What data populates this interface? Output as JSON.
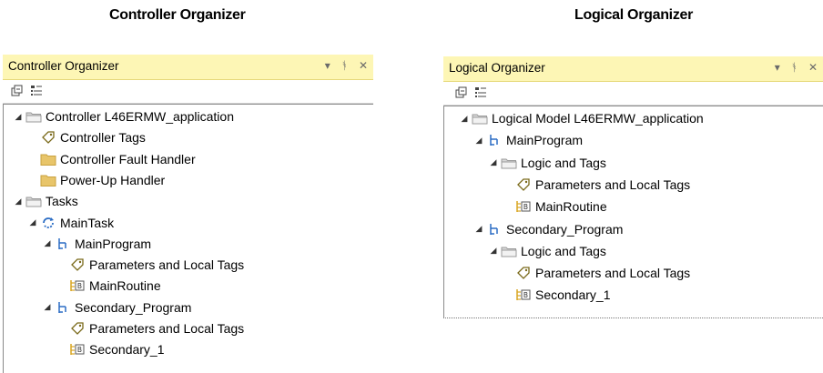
{
  "captions": {
    "left": "Controller Organizer",
    "right": "Logical Organizer"
  },
  "controller_organizer": {
    "title": "Controller Organizer",
    "title_icons": [
      "dropdown-icon",
      "pin-icon",
      "close-icon"
    ],
    "toolbar_icons": [
      "collapse-all-icon",
      "expand-all-icon"
    ],
    "items": [
      {
        "label": "Controller L46ERMW_application",
        "icon": "folder-open-icon",
        "expanded": true
      },
      {
        "label": "Controller Tags",
        "icon": "tag-icon"
      },
      {
        "label": "Controller Fault Handler",
        "icon": "folder-icon"
      },
      {
        "label": "Power-Up Handler",
        "icon": "folder-icon"
      },
      {
        "label": "Tasks",
        "icon": "folder-open-icon",
        "expanded": true
      },
      {
        "label": "MainTask",
        "icon": "task-cycle-icon",
        "expanded": true
      },
      {
        "label": "MainProgram",
        "icon": "program-icon",
        "expanded": true
      },
      {
        "label": "Parameters and Local Tags",
        "icon": "tag-icon"
      },
      {
        "label": "MainRoutine",
        "icon": "routine-icon"
      },
      {
        "label": "Secondary_Program",
        "icon": "program-icon",
        "expanded": true
      },
      {
        "label": "Parameters and Local Tags",
        "icon": "tag-icon"
      },
      {
        "label": "Secondary_1",
        "icon": "routine-icon"
      }
    ]
  },
  "logical_organizer": {
    "title": "Logical Organizer",
    "title_icons": [
      "dropdown-icon",
      "pin-icon",
      "close-icon"
    ],
    "toolbar_icons": [
      "collapse-all-icon",
      "expand-all-icon"
    ],
    "items": [
      {
        "label": "Logical Model L46ERMW_application",
        "icon": "folder-open-icon",
        "expanded": true
      },
      {
        "label": "MainProgram",
        "icon": "program-icon",
        "expanded": true
      },
      {
        "label": "Logic and Tags",
        "icon": "folder-open-icon",
        "expanded": true
      },
      {
        "label": "Parameters and Local Tags",
        "icon": "tag-icon"
      },
      {
        "label": "MainRoutine",
        "icon": "routine-icon"
      },
      {
        "label": "Secondary_Program",
        "icon": "program-icon",
        "expanded": true
      },
      {
        "label": "Logic and Tags",
        "icon": "folder-open-icon",
        "expanded": true
      },
      {
        "label": "Parameters and Local Tags",
        "icon": "tag-icon"
      },
      {
        "label": "Secondary_1",
        "icon": "routine-icon"
      }
    ]
  },
  "colors": {
    "titlebar": "#fdf6b5",
    "folder": "#e8c56a",
    "folder_dark": "#c9a13e",
    "program_icon": "#2a6cc4",
    "routine_icon": "#d9a520"
  }
}
